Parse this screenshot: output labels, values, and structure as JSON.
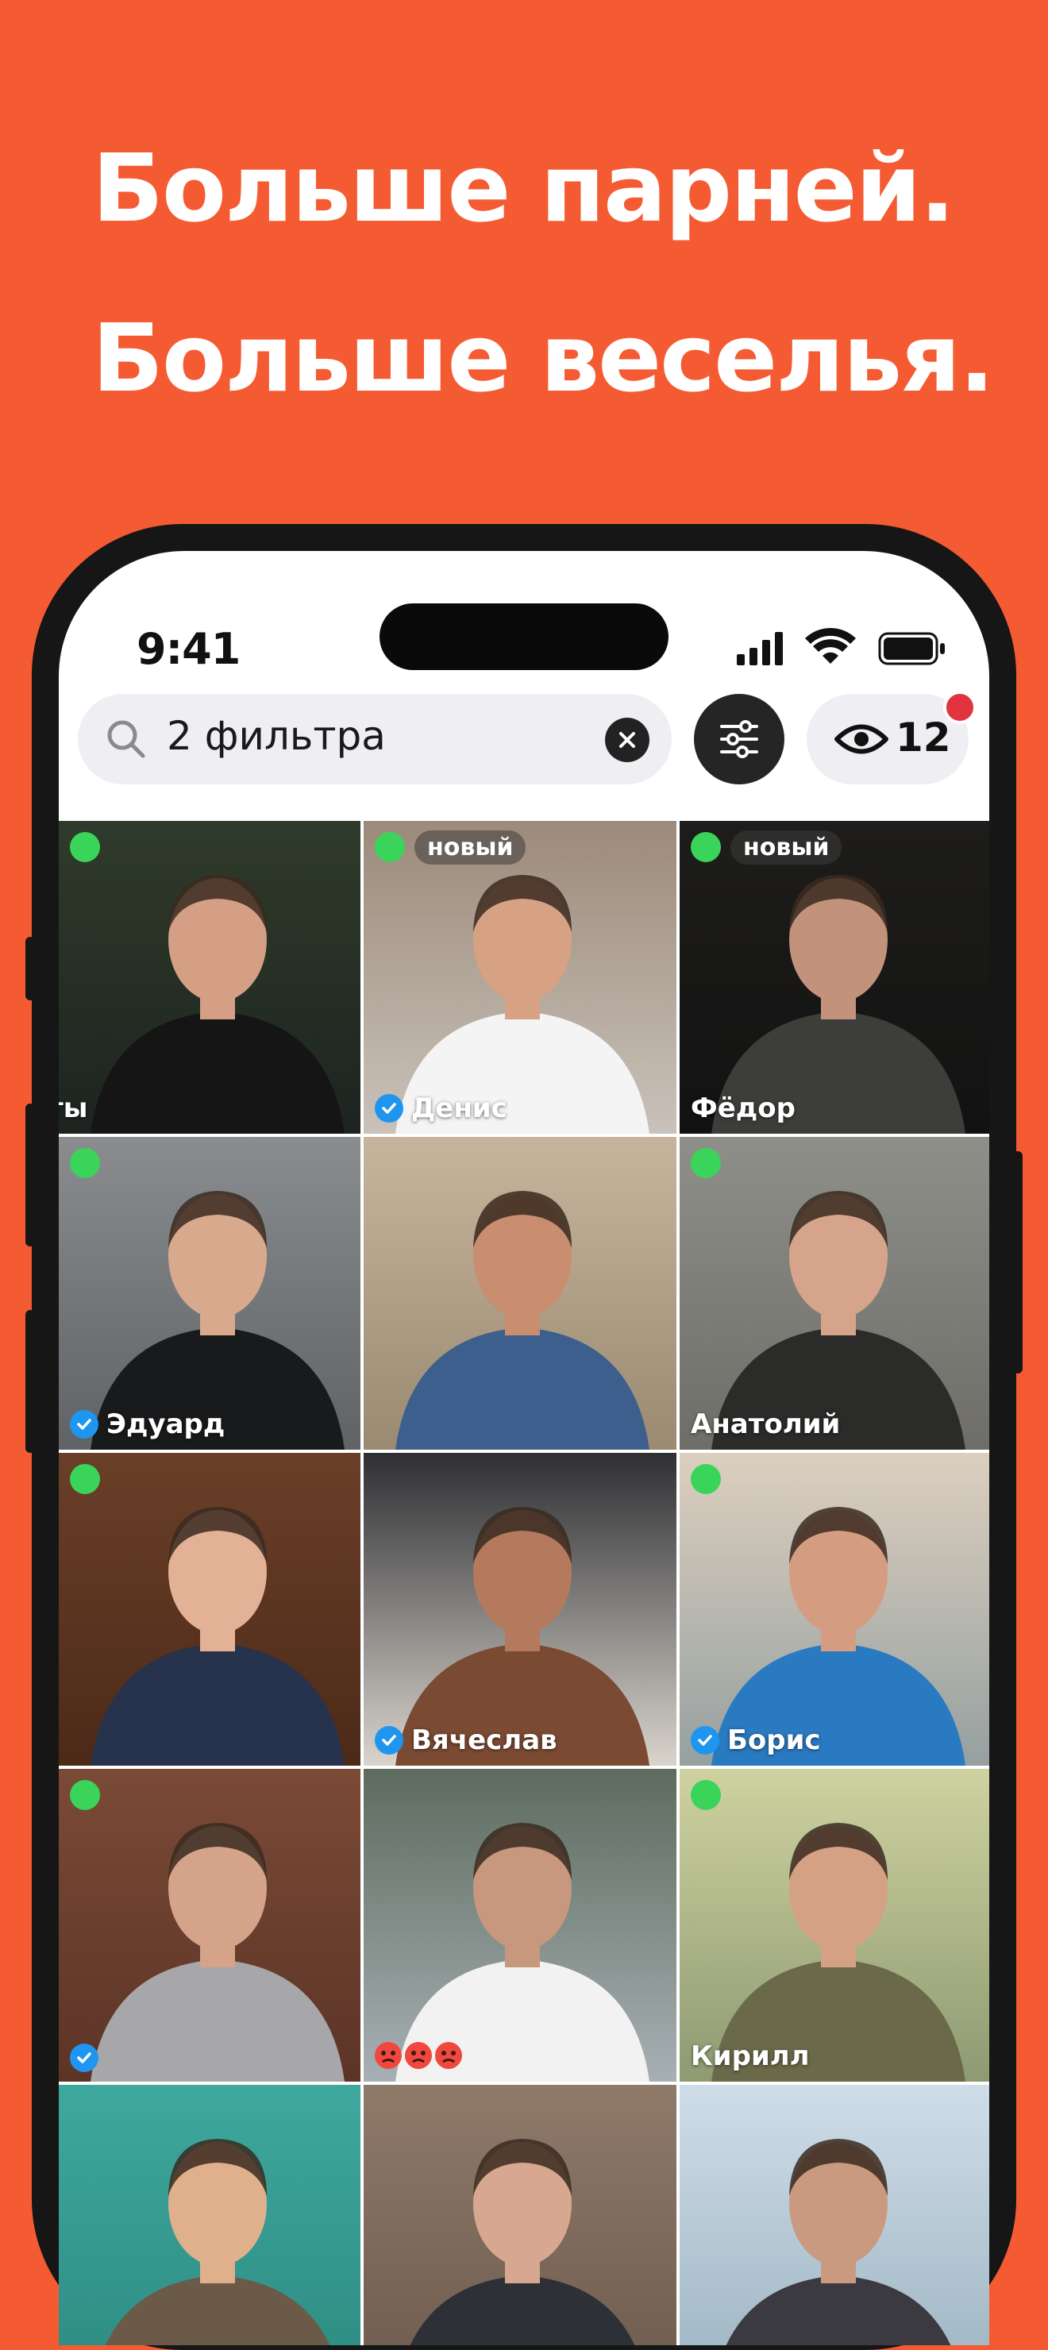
{
  "headline": {
    "line1": "Больше парней.",
    "line2": "Больше веселья."
  },
  "status_bar": {
    "time": "9:41"
  },
  "search": {
    "value": "2 фильтра"
  },
  "views": {
    "count": "12"
  },
  "colors": {
    "background": "#F55B32",
    "online": "#3BD45A",
    "verified": "#1E96F0",
    "notification": "#E2343F"
  },
  "profiles": [
    {
      "name": "ты",
      "online": true,
      "verified": false,
      "new": false,
      "new_label": ""
    },
    {
      "name": "Денис",
      "online": true,
      "verified": true,
      "new": true,
      "new_label": "новый"
    },
    {
      "name": "Фёдор",
      "online": true,
      "verified": false,
      "new": true,
      "new_label": "новый"
    },
    {
      "name": "Эдуард",
      "online": true,
      "verified": true,
      "new": false,
      "new_label": ""
    },
    {
      "name": "",
      "online": false,
      "verified": false,
      "new": false,
      "new_label": ""
    },
    {
      "name": "Анатолий",
      "online": true,
      "verified": false,
      "new": false,
      "new_label": ""
    },
    {
      "name": "",
      "online": true,
      "verified": false,
      "new": false,
      "new_label": ""
    },
    {
      "name": "Вячеслав",
      "online": false,
      "verified": true,
      "new": false,
      "new_label": ""
    },
    {
      "name": "Борис",
      "online": true,
      "verified": true,
      "new": false,
      "new_label": ""
    },
    {
      "name": "",
      "online": true,
      "verified": true,
      "new": false,
      "new_label": ""
    },
    {
      "name": "",
      "online": false,
      "verified": false,
      "new": false,
      "new_label": "",
      "emojis": 3
    },
    {
      "name": "Кирилл",
      "online": true,
      "verified": false,
      "new": false,
      "new_label": ""
    },
    {
      "name": "",
      "online": false,
      "verified": false,
      "new": false,
      "new_label": ""
    },
    {
      "name": "",
      "online": false,
      "verified": false,
      "new": false,
      "new_label": ""
    },
    {
      "name": "",
      "online": false,
      "verified": false,
      "new": false,
      "new_label": ""
    }
  ]
}
